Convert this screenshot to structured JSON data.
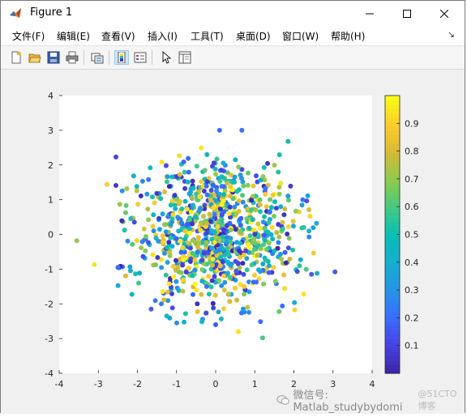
{
  "window": {
    "title": "Figure 1"
  },
  "menu": [
    {
      "label": "文件(F)"
    },
    {
      "label": "编辑(E)"
    },
    {
      "label": "查看(V)"
    },
    {
      "label": "插入(I)"
    },
    {
      "label": "工具(T)"
    },
    {
      "label": "桌面(D)"
    },
    {
      "label": "窗口(W)"
    },
    {
      "label": "帮助(H)"
    }
  ],
  "toolbar_icons": [
    "new-figure-icon",
    "open-icon",
    "save-icon",
    "print-icon",
    "link-plot-icon",
    "insert-colorbar-icon",
    "insert-legend-icon",
    "edit-plot-icon",
    "property-inspector-icon"
  ],
  "watermark": {
    "text": "微信号: Matlab_studybydomi",
    "sub": "@51CTO博客"
  },
  "chart_data": {
    "type": "scatter",
    "title": "",
    "xlabel": "",
    "ylabel": "",
    "xlim": [
      -4,
      4
    ],
    "ylim": [
      -4,
      4
    ],
    "xticks": [
      "-4",
      "-3",
      "-2",
      "-1",
      "0",
      "1",
      "2",
      "3",
      "4"
    ],
    "yticks": [
      "-4",
      "-3",
      "-2",
      "-1",
      "0",
      "1",
      "2",
      "3",
      "4"
    ],
    "colormap": "parula",
    "colorbar": {
      "clim": [
        0,
        1
      ],
      "ticks": [
        "0.1",
        "0.2",
        "0.3",
        "0.4",
        "0.5",
        "0.6",
        "0.7",
        "0.8",
        "0.9"
      ],
      "position": "right"
    },
    "grid": false,
    "n_points": 1000,
    "distribution": "x, y ~ standard normal; color ~ uniform(0,1)",
    "points": [
      {
        "x": -3.55,
        "y": -0.18,
        "c": 0.7
      },
      {
        "x": -3.1,
        "y": -0.87,
        "c": 0.95
      },
      {
        "x": -2.55,
        "y": 2.23,
        "c": 0.1
      },
      {
        "x": -2.55,
        "y": 1.41,
        "c": 0.05
      },
      {
        "x": -2.45,
        "y": 0.87,
        "c": 0.7
      },
      {
        "x": -2.78,
        "y": 1.44,
        "c": 0.9
      },
      {
        "x": -2.5,
        "y": -0.95,
        "c": 0.2
      },
      {
        "x": 0.1,
        "y": 3.0,
        "c": 0.2
      },
      {
        "x": 0.67,
        "y": 3.0,
        "c": 0.2
      },
      {
        "x": 1.85,
        "y": 2.68,
        "c": 0.45
      },
      {
        "x": 3.05,
        "y": -1.08,
        "c": 0.15
      },
      {
        "x": 2.45,
        "y": -1.15,
        "c": 0.15
      },
      {
        "x": 2.25,
        "y": -1.72,
        "c": 0.95
      },
      {
        "x": 0.0,
        "y": -2.6,
        "c": 0.15
      },
      {
        "x": 0.58,
        "y": -2.8,
        "c": 0.95
      },
      {
        "x": 1.2,
        "y": -2.98,
        "c": 0.6
      },
      {
        "x": -1.25,
        "y": -2.35,
        "c": 0.45
      },
      {
        "x": -1.65,
        "y": -2.15,
        "c": 0.15
      },
      {
        "x": 2.05,
        "y": 0.67,
        "c": 0.7
      },
      {
        "x": 2.25,
        "y": 0.2,
        "c": 0.55
      }
    ]
  }
}
